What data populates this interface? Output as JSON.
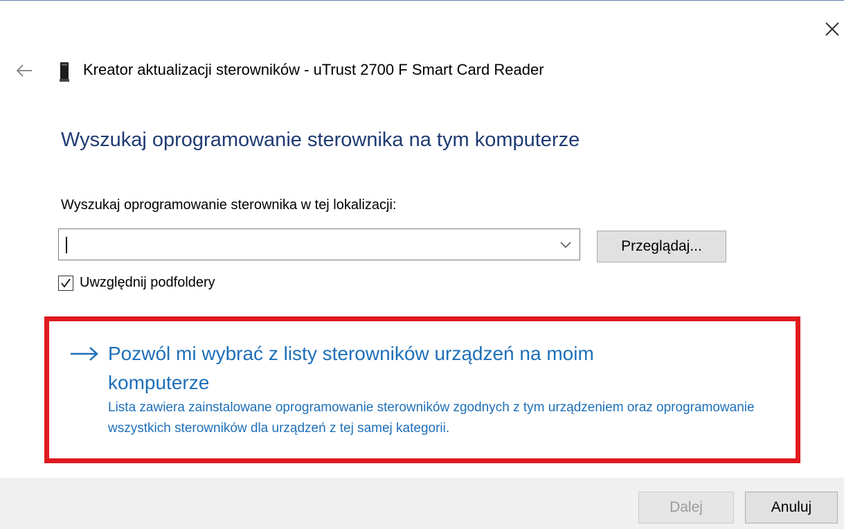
{
  "window": {
    "title": "Kreator aktualizacji sterowników - uTrust 2700 F Smart Card Reader",
    "close_icon": "close-icon",
    "back_icon": "back-arrow-icon",
    "device_icon": "smart-card-reader-icon"
  },
  "main": {
    "heading": "Wyszukaj oprogramowanie sterownika na tym komputerze",
    "location_label": "Wyszukaj oprogramowanie sterownika w tej lokalizacji:",
    "location_value": "",
    "browse_label": "Przeglądaj...",
    "include_subfolders": {
      "label": "Uwzględnij podfoldery",
      "checked": true
    }
  },
  "choose_from_list": {
    "title": "Pozwól mi wybrać z listy sterowników urządzeń na moim komputerze",
    "description": "Lista zawiera zainstalowane oprogramowanie sterowników zgodnych z tym urządzeniem oraz oprogramowanie wszystkich sterowników dla urządzeń z tej samej kategorii.",
    "highlight_color": "#e0191f",
    "link_color": "#1e6fb8"
  },
  "footer": {
    "next_label": "Dalej",
    "next_enabled": false,
    "cancel_label": "Anuluj"
  },
  "colors": {
    "heading": "#1f3b73",
    "footer_bg": "#f0f0f0"
  }
}
